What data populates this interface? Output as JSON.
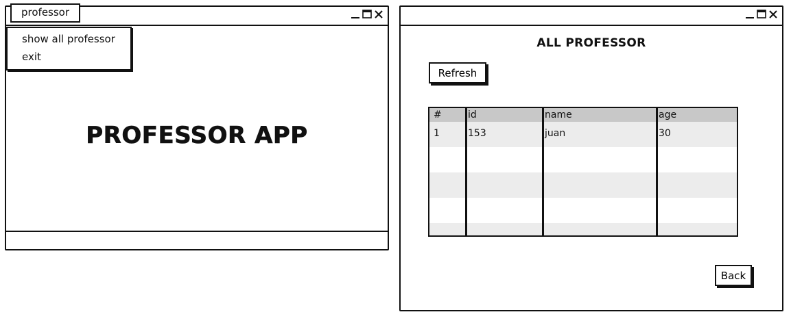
{
  "left_window": {
    "menu_tab_label": "professor",
    "menu_items": [
      {
        "label": "show all professor"
      },
      {
        "label": "exit"
      }
    ],
    "app_title": "PROFESSOR APP",
    "controls": {
      "minimize_icon": "minimize-icon",
      "maximize_icon": "maximize-icon",
      "close_icon": "close-icon"
    }
  },
  "right_window": {
    "heading": "ALL PROFESSOR",
    "refresh_label": "Refresh",
    "back_label": "Back",
    "table": {
      "columns": [
        "#",
        "id",
        "name",
        "age"
      ],
      "rows": [
        [
          "1",
          "153",
          "juan",
          "30"
        ]
      ]
    },
    "controls": {
      "minimize_icon": "minimize-icon",
      "maximize_icon": "maximize-icon",
      "close_icon": "close-icon"
    }
  },
  "colors": {
    "stroke": "#111111",
    "header_fill": "#c8c8c8",
    "alt_row_fill": "#ececec",
    "background": "#ffffff"
  }
}
